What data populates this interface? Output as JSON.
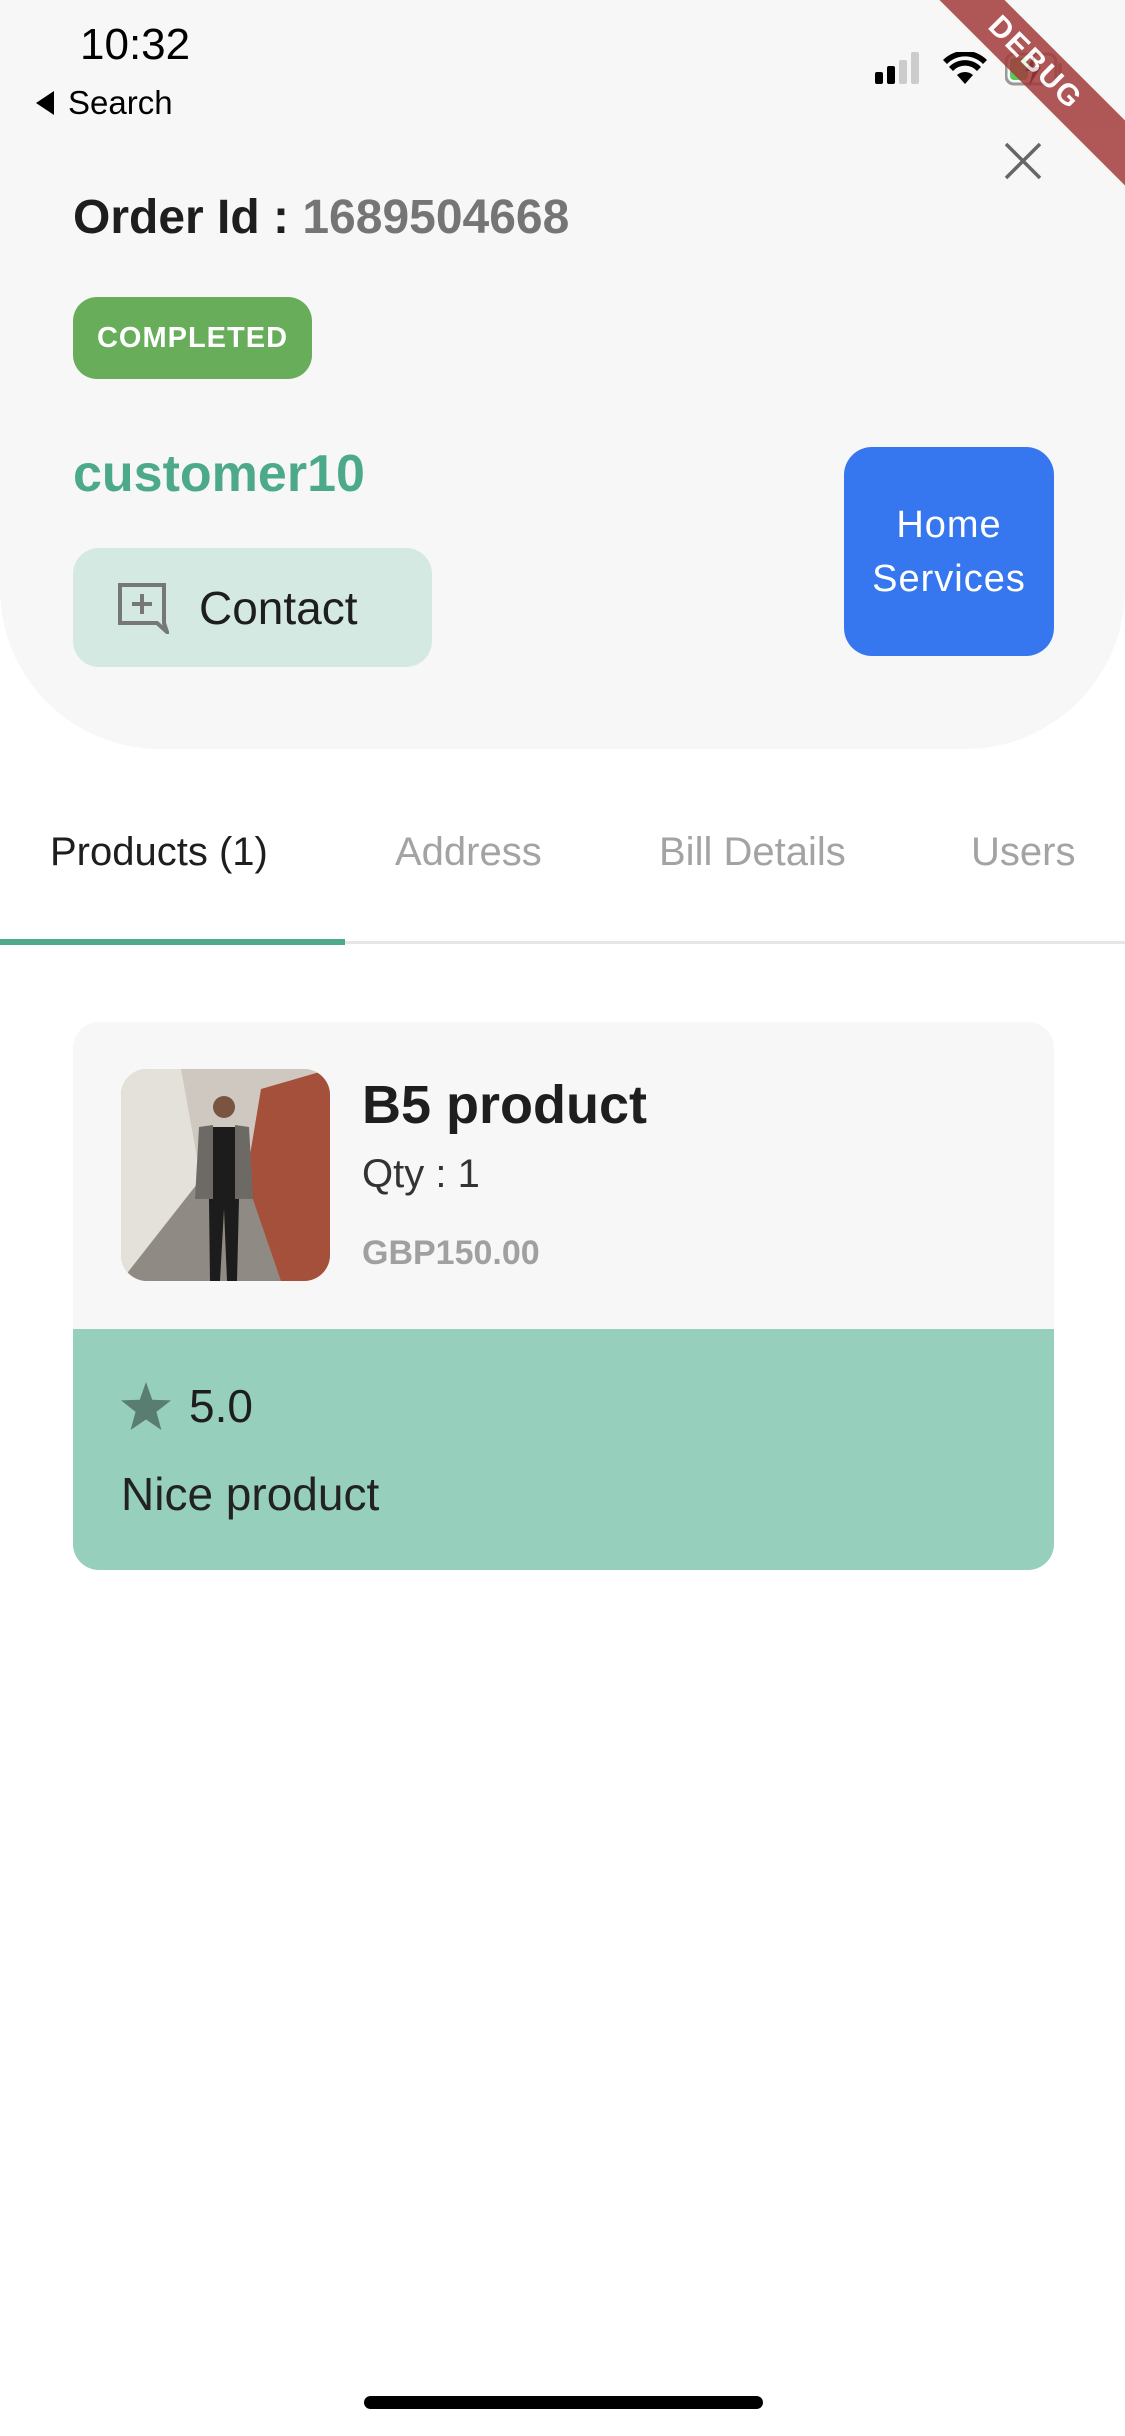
{
  "status_bar": {
    "time": "10:32",
    "back_label": "Search"
  },
  "debug_banner": "DEBUG",
  "order": {
    "label": "Order Id : ",
    "id": "1689504668",
    "status": "COMPLETED",
    "customer": "customer10",
    "contact_label": "Contact",
    "service_label": "Home Services"
  },
  "colors": {
    "accent": "#4caa8a",
    "status": "#68ad5a",
    "service": "#3677f0",
    "review_bg": "#96d0bd"
  },
  "tabs": [
    {
      "label": "Products (1)",
      "active": true
    },
    {
      "label": "Address"
    },
    {
      "label": "Bill Details"
    },
    {
      "label": "Users"
    }
  ],
  "products": [
    {
      "name": "B5 product",
      "qty": "Qty : 1",
      "price": "GBP150.00",
      "rating": "5.0",
      "review": "Nice product"
    }
  ]
}
